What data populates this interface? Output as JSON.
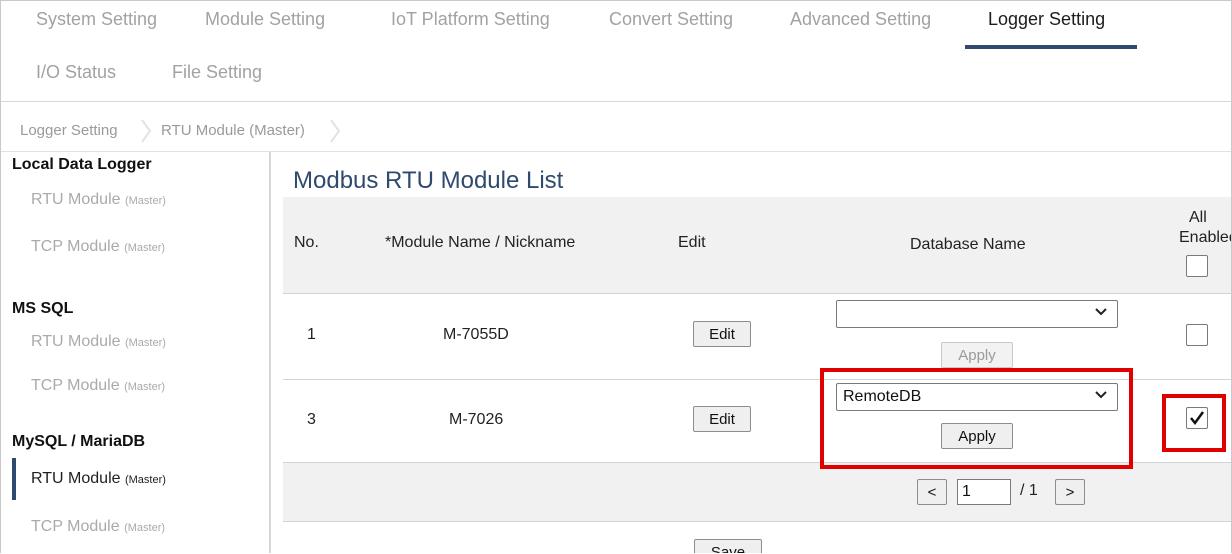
{
  "tabs": {
    "row1": [
      "System Setting",
      "Module Setting",
      "IoT Platform Setting",
      "Convert Setting",
      "Advanced Setting",
      "Logger Setting"
    ],
    "row2": [
      "I/O Status",
      "File Setting"
    ],
    "active": "Logger Setting"
  },
  "breadcrumb": [
    "Logger Setting",
    "RTU Module (Master)"
  ],
  "sidebar": {
    "groups": [
      {
        "title": "Local Data Logger",
        "items": [
          {
            "label": "RTU Module",
            "sub": "(Master)"
          },
          {
            "label": "TCP Module",
            "sub": "(Master)"
          }
        ]
      },
      {
        "title": "MS SQL",
        "items": [
          {
            "label": "RTU Module",
            "sub": "(Master)"
          },
          {
            "label": "TCP Module",
            "sub": "(Master)"
          }
        ]
      },
      {
        "title": "MySQL / MariaDB",
        "items": [
          {
            "label": "RTU Module",
            "sub": "(Master)"
          },
          {
            "label": "TCP Module",
            "sub": "(Master)"
          }
        ]
      }
    ]
  },
  "main": {
    "title": "Modbus RTU Module List",
    "headers": {
      "no": "No.",
      "name": "*Module Name / Nickname",
      "edit": "Edit",
      "db": "Database Name",
      "all_top": "All",
      "all_bottom": "Enabled"
    },
    "rows": [
      {
        "no": "1",
        "name": "M-7055D",
        "edit": "Edit",
        "db_value": "",
        "apply": "Apply",
        "enabled": false
      },
      {
        "no": "3",
        "name": "M-7026",
        "edit": "Edit",
        "db_value": "RemoteDB",
        "apply": "Apply",
        "enabled": true
      }
    ],
    "pager": {
      "prev": "<",
      "page": "1",
      "total": "/ 1",
      "next": ">"
    },
    "save": "Save"
  },
  "colors": {
    "accent": "#2f4a6e",
    "highlight": "#e00000"
  }
}
